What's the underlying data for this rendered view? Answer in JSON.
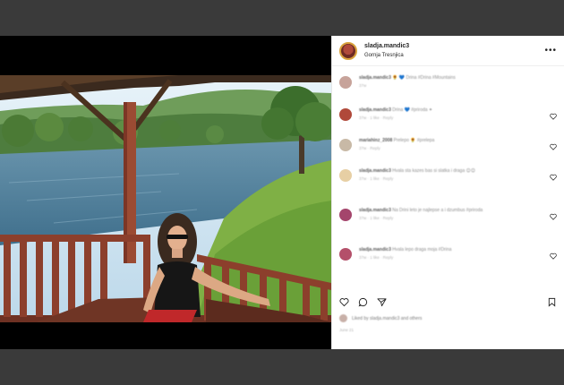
{
  "post": {
    "username": "sladja.mandic3",
    "location": "Gornja Tresnjica",
    "more_label": "•••"
  },
  "colors": {
    "avatar_ring": "#d9a13c",
    "link_blue": "#7fb4e8",
    "backdrop": "#3a3a3a"
  },
  "comments": [
    {
      "user": "sladja.mandic3",
      "text": "🌻 💙 Drina #Drina #Mountains",
      "meta": "37w",
      "has_like": false,
      "avatar_color": "#c7a39a"
    },
    {
      "user": "sladja.mandic3",
      "text": "Drina 💙 #priroda ✦",
      "meta": "37w · 1 like · Reply",
      "has_like": true,
      "avatar_color": "#b0493a"
    },
    {
      "user": "mariahinz_2008",
      "text": "Prelepo 🌻 #prelepa",
      "meta": "37w · Reply",
      "has_like": true,
      "avatar_color": "#c8b9a6"
    },
    {
      "user": "sladja.mandic3",
      "text": "Hvala sta kazes bas si slatka i draga 😊😊",
      "meta": "37w · 1 like · Reply",
      "has_like": true,
      "avatar_color": "#e7cfa4"
    },
    {
      "user": "sladja.mandic3",
      "text": "Na Drini leto je najlepse a i dzumbus #priroda",
      "meta": "37w · 1 like · Reply",
      "has_like": true,
      "avatar_color": "#a4456c"
    },
    {
      "user": "sladja.mandic3",
      "text": "Hvala lepo draga moja #Drina",
      "meta": "37w · 1 like · Reply",
      "has_like": true,
      "avatar_color": "#b4506a"
    }
  ],
  "likes_text": "Liked by sladja.mandic3 and others",
  "post_date": "June 21"
}
